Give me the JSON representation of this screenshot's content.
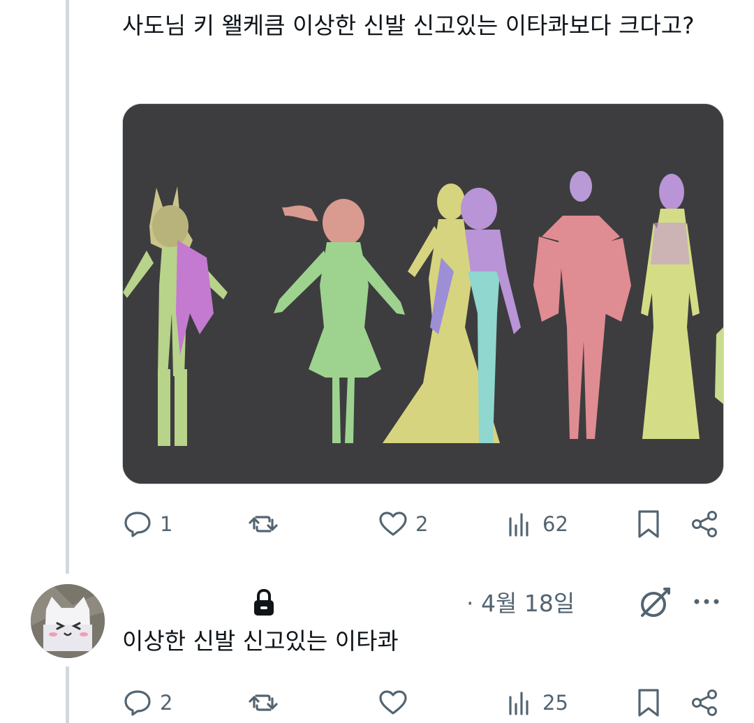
{
  "post": {
    "text": "사도님 키 왤케큼 이상한 신발 신고있는 이타콰보다 크다고?",
    "media_alt": "",
    "actions": {
      "reply_count": "1",
      "repost_count": "",
      "like_count": "2",
      "views_count": "62"
    }
  },
  "reply": {
    "date": "· 4월 18일",
    "text": "이상한 신발 신고있는 이타콰",
    "actions": {
      "reply_count": "2",
      "repost_count": "",
      "like_count": "",
      "views_count": "25"
    }
  },
  "icons": {
    "reply": "speech-bubble-icon",
    "repost": "repost-arrows-icon",
    "like": "heart-icon",
    "views": "bar-chart-icon",
    "bookmark": "bookmark-icon",
    "share": "share-icon",
    "lock": "lock-icon",
    "grok": "grok-icon",
    "more": "more-dots-icon"
  },
  "colors": {
    "text_primary": "#0f1419",
    "text_secondary": "#536471",
    "thread_line": "#cfd9de",
    "media_bg": "#3d3d3f"
  }
}
